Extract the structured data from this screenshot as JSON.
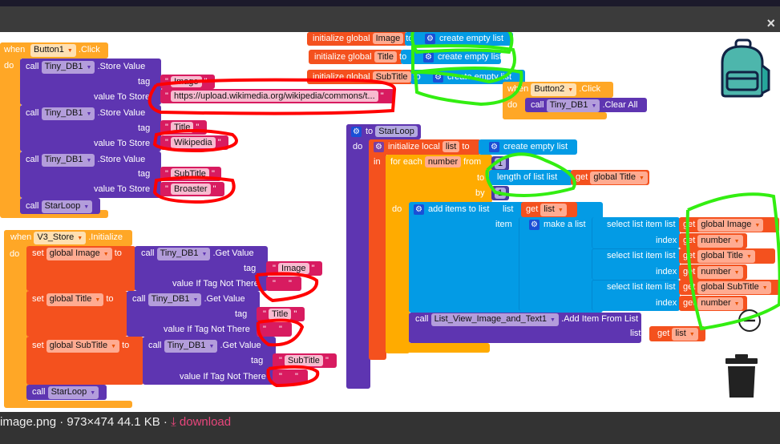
{
  "lightbox": {
    "close_icon": "×",
    "filename": "image.png",
    "meta": " · 973×474 44.1 KB · ",
    "download": "download",
    "download_icon": "download-icon"
  },
  "colors": {
    "event": "#ffa726",
    "procedure_call": "#5e35b1",
    "text": "#d81b60",
    "variable": "#f4511e",
    "list": "#039be5",
    "red_annotation": "#ff0000",
    "green_annotation": "#33ee11",
    "download": "#e8467c"
  },
  "button1": {
    "when": "when",
    "component": "Button1",
    "event": ".Click",
    "do": "do",
    "calls": [
      {
        "call": "call",
        "component": "Tiny_DB1",
        "method": ".Store Value",
        "tag_label": "tag",
        "value_label": "value To Store",
        "tag": "Image",
        "value": "https://upload.wikimedia.org/wikipedia/commons/t..."
      },
      {
        "call": "call",
        "component": "Tiny_DB1",
        "method": ".Store Value",
        "tag_label": "tag",
        "value_label": "value To Store",
        "tag": "Title",
        "value": "Wikipedia"
      },
      {
        "call": "call",
        "component": "Tiny_DB1",
        "method": ".Store Value",
        "tag_label": "tag",
        "value_label": "value To Store",
        "tag": "SubTitle",
        "value": "Broaster"
      }
    ],
    "final_call": {
      "call": "call",
      "procedure": "StarLoop"
    }
  },
  "globals": [
    {
      "label": "initialize global",
      "name": "Image",
      "to": "to",
      "value": "create empty list"
    },
    {
      "label": "initialize global",
      "name": "Title",
      "to": "to",
      "value": "create empty list"
    },
    {
      "label": "initialize global",
      "name": "SubTitle",
      "to": "to",
      "value": "create empty list"
    }
  ],
  "button2": {
    "when": "when",
    "component": "Button2",
    "event": ".Click",
    "do": "do",
    "call": "call",
    "target": "Tiny_DB1",
    "method": ".Clear All"
  },
  "v3store": {
    "when": "when",
    "component": "V3_Store",
    "event": ".Initialize",
    "do": "do",
    "sets": [
      {
        "set": "set",
        "var": "global Image",
        "to": "to",
        "call": "call",
        "component": "Tiny_DB1",
        "method": ".Get Value",
        "tag_label": "tag",
        "default_label": "value If Tag Not There",
        "tag": "Image",
        "default": ""
      },
      {
        "set": "set",
        "var": "global Title",
        "to": "to",
        "call": "call",
        "component": "Tiny_DB1",
        "method": ".Get Value",
        "tag_label": "tag",
        "default_label": "value If Tag Not There",
        "tag": "Title",
        "default": ""
      },
      {
        "set": "set",
        "var": "global SubTitle",
        "to": "to",
        "call": "call",
        "component": "Tiny_DB1",
        "method": ".Get Value",
        "tag_label": "tag",
        "default_label": "value If Tag Not There",
        "tag": "SubTitle",
        "default": ""
      }
    ],
    "final_call": {
      "call": "call",
      "procedure": "StarLoop"
    }
  },
  "starloop": {
    "to": "to",
    "name": "StarLoop",
    "do": "do",
    "init_local": "initialize local",
    "local_name": "list",
    "local_to": "to",
    "local_value": "create empty list",
    "in": "in",
    "for_each": "for each",
    "loop_var": "number",
    "from": "from",
    "from_value": "1",
    "to_label": "to",
    "length_of_list": "length of list  list",
    "get": "get",
    "length_target": "global Title",
    "by": "by",
    "by_value": "1",
    "loop_do": "do",
    "add_items": "add items to list",
    "list_label": "list",
    "list_target": "list",
    "item_label": "item",
    "make_a_list": "make a list",
    "selects": [
      {
        "label": "select list item  list",
        "index_label": "index",
        "list": "global Image",
        "index": "number"
      },
      {
        "label": "select list item  list",
        "index_label": "index",
        "list": "global Title",
        "index": "number"
      },
      {
        "label": "select list item  list",
        "index_label": "index",
        "list": "global SubTitle",
        "index": "number"
      }
    ],
    "final_call": {
      "call": "call",
      "component": "List_View_Image_and_Text1",
      "method": ".Add Item From List",
      "list_label": "list",
      "list_value": "list"
    }
  },
  "workspace_icons": [
    "backpack-icon",
    "trash-icon",
    "zoom-out-icon"
  ]
}
